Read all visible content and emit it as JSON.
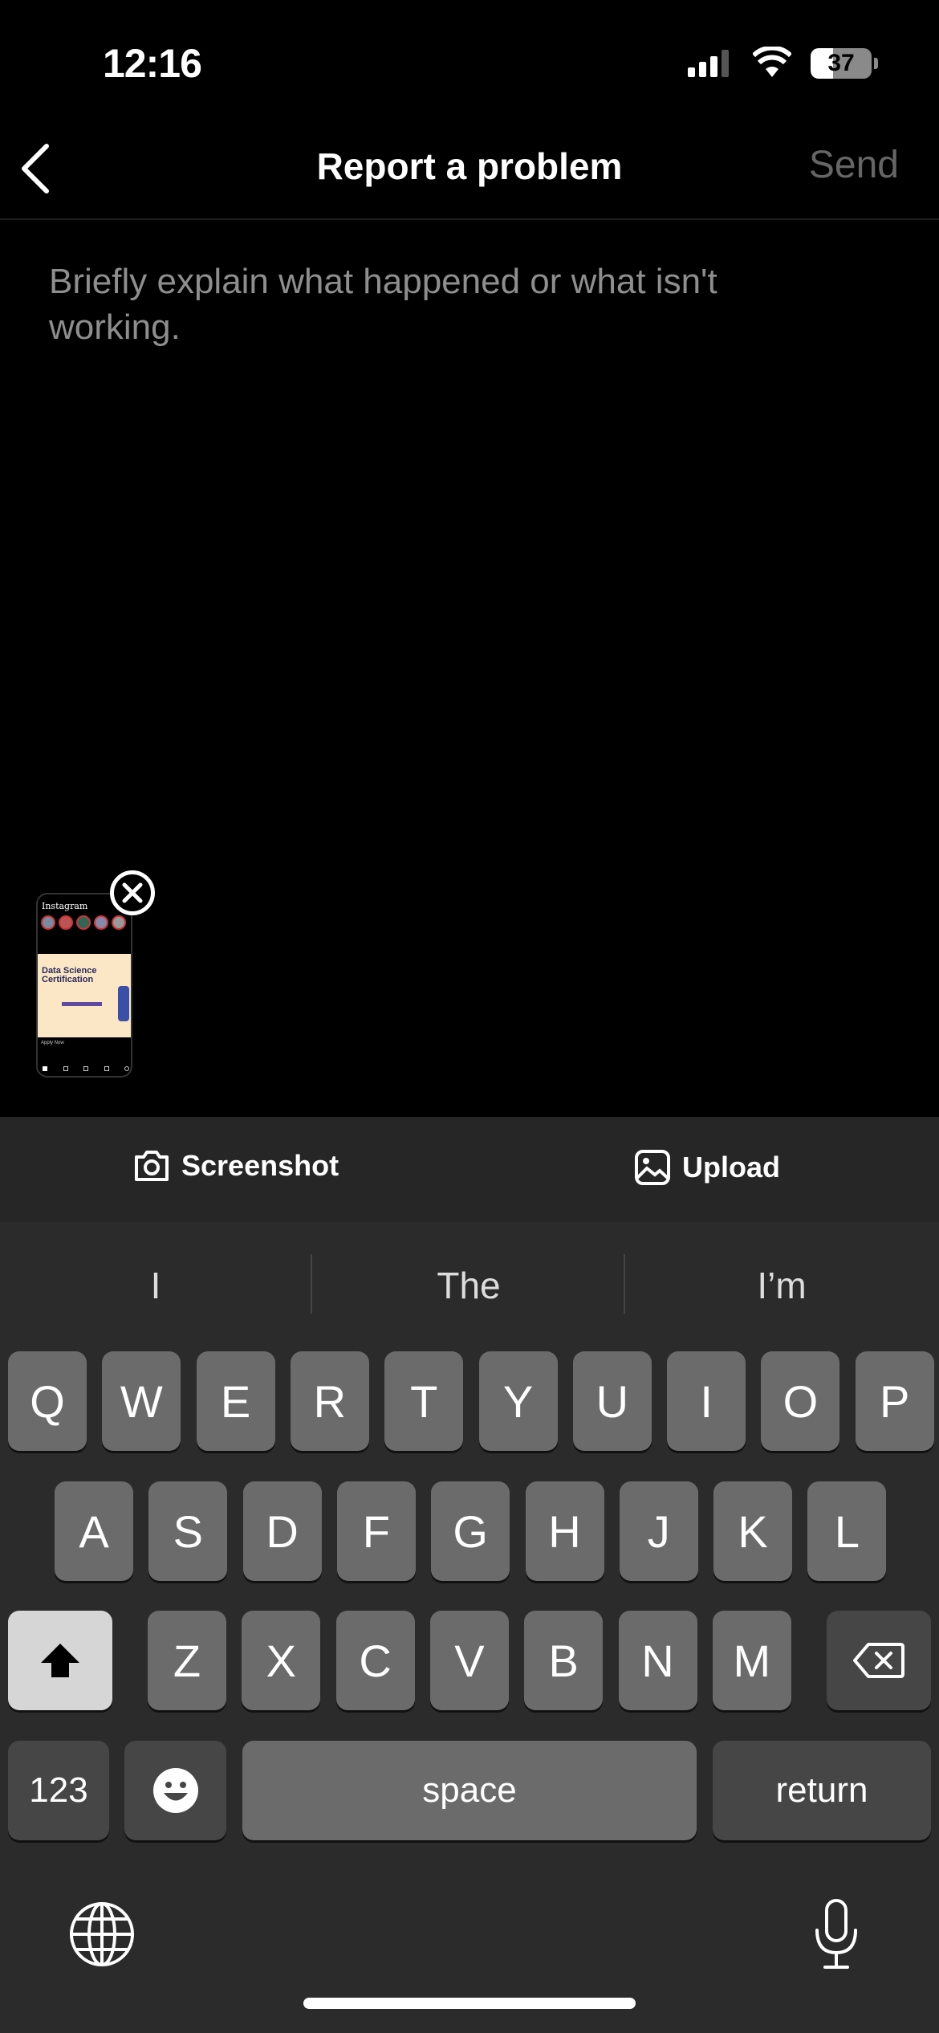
{
  "status_bar": {
    "time": "12:16",
    "battery": "37"
  },
  "nav": {
    "title": "Report a problem",
    "send": "Send"
  },
  "body": {
    "placeholder": "Briefly explain what happened or what isn't working."
  },
  "attachment": {
    "app": "Instagram",
    "headline1": "Data Science",
    "headline2": "Certification",
    "cta": "Apply Now"
  },
  "toolbar": {
    "screenshot": "Screenshot",
    "upload": "Upload"
  },
  "keyboard": {
    "suggestions": [
      "I",
      "The",
      "I’m"
    ],
    "row1": [
      "Q",
      "W",
      "E",
      "R",
      "T",
      "Y",
      "U",
      "I",
      "O",
      "P"
    ],
    "row2": [
      "A",
      "S",
      "D",
      "F",
      "G",
      "H",
      "J",
      "K",
      "L"
    ],
    "row3": [
      "Z",
      "X",
      "C",
      "V",
      "B",
      "N",
      "M"
    ],
    "numbers": "123",
    "space": "space",
    "return": "return"
  }
}
